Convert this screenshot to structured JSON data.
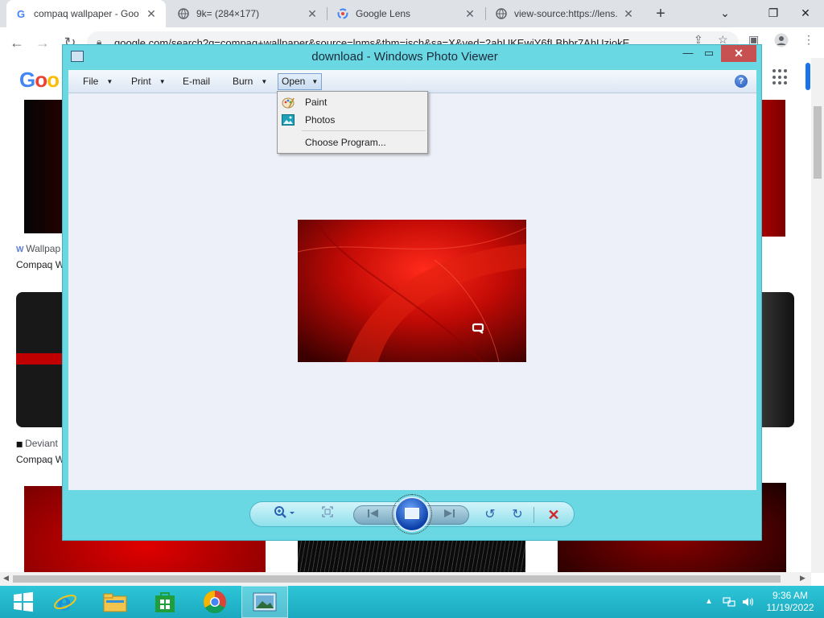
{
  "browser": {
    "tabs": [
      {
        "title": "compaq wallpaper - Goo",
        "favicon": "google-g-icon",
        "active": true
      },
      {
        "title": "9k= (284×177)",
        "favicon": "globe-icon",
        "active": false
      },
      {
        "title": "Google Lens",
        "favicon": "google-lens-icon",
        "active": false
      },
      {
        "title": "view-source:https://lens.",
        "favicon": "globe-icon",
        "active": false
      }
    ],
    "url": "google.com/search?q=compaq+wallpaper&source=lnms&tbm=isch&sa=X&ved=2ahUKEwjY6fLBbbr7AhUziokE",
    "new_tab_label": "+"
  },
  "google": {
    "logo": [
      "G",
      "o",
      "o"
    ],
    "results": [
      {
        "source": "Wallpap",
        "title": "Compaq W"
      },
      {
        "source": "Deviant",
        "title": "Compaq W"
      }
    ]
  },
  "photo_viewer": {
    "title": "download - Windows Photo Viewer",
    "menu": {
      "file": "File",
      "print": "Print",
      "email": "E-mail",
      "burn": "Burn",
      "open": "Open",
      "help": "?"
    },
    "open_menu": {
      "items": [
        {
          "label": "Paint",
          "icon": "paint-icon"
        },
        {
          "label": "Photos",
          "icon": "photos-icon"
        },
        {
          "label": "Choose Program...",
          "icon": ""
        }
      ]
    },
    "controls": [
      "zoom-icon",
      "actual-size-icon",
      "previous-icon",
      "slideshow-icon",
      "next-icon",
      "rotate-counterclockwise-icon",
      "rotate-clockwise-icon",
      "delete-icon"
    ]
  },
  "taskbar": {
    "apps": [
      "start-icon",
      "internet-explorer-icon",
      "file-explorer-icon",
      "store-icon",
      "chrome-icon",
      "photo-viewer-icon"
    ],
    "time": "9:36 AM",
    "date": "11/19/2022"
  },
  "colors": {
    "wpv_frame": "#6ad8e3",
    "taskbar": "#2ec6d8",
    "close_red": "#c75050",
    "delete_red": "#d22a2a"
  }
}
